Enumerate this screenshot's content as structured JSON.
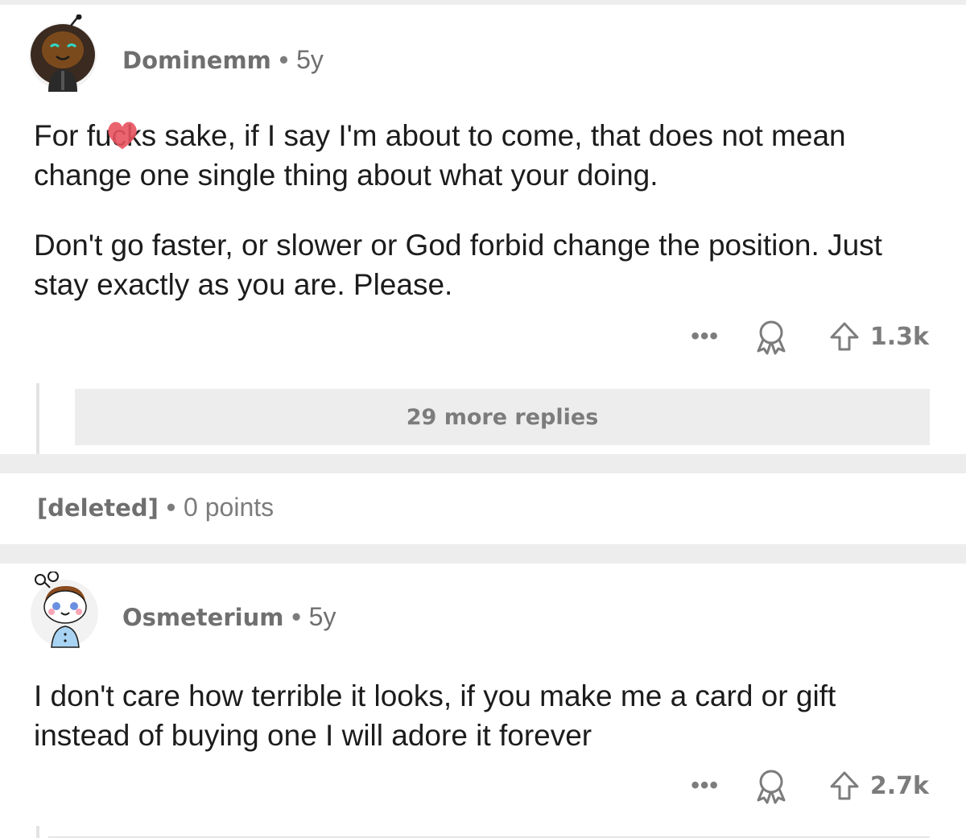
{
  "comments": [
    {
      "username": "Dominemm",
      "separator": "•",
      "age": "5y",
      "paragraphs": [
        "For fucks sake, if I say I'm about to come, that does not mean change one single thing about what your doing.",
        "Don't go faster, or slower or God forbid change the position. Just stay exactly as you are. Please."
      ],
      "more_icon": "more-options-icon",
      "award_icon": "award-icon",
      "upvote_icon": "upvote-arrow-icon",
      "score": "1.3k",
      "more_replies": "29 more replies"
    },
    {
      "username": "[deleted]",
      "separator": "•",
      "points": "0 points"
    },
    {
      "username": "Osmeterium",
      "separator": "•",
      "age": "5y",
      "paragraphs": [
        "I don't care how terrible it looks, if you make me a card or gift instead of buying one I will adore it forever"
      ],
      "more_icon": "more-options-icon",
      "award_icon": "award-icon",
      "upvote_icon": "upvote-arrow-icon",
      "score": "2.7k"
    }
  ],
  "overlay": {
    "heart_sticker": "heart-sticker-icon"
  },
  "colors": {
    "background": "#ffffff",
    "separator": "#ededed",
    "meta_text": "#7c7c7c",
    "body_text": "#1c1c1c",
    "heart": "#e8535f"
  }
}
